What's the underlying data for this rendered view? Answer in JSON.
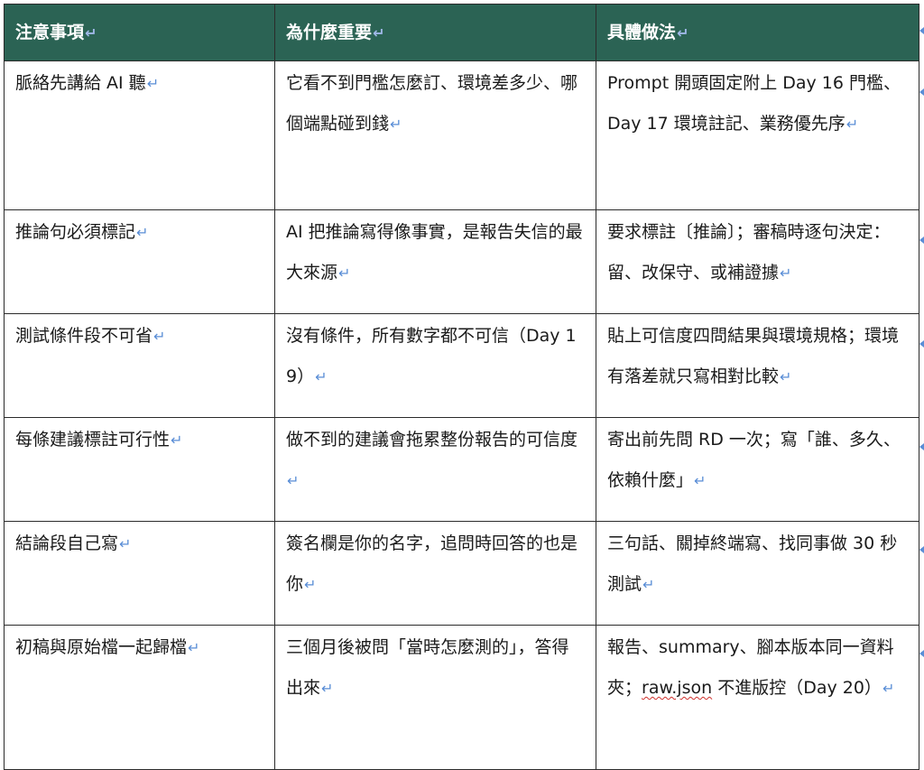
{
  "table": {
    "headers": [
      "注意事項",
      "為什麼重要",
      "具體做法"
    ],
    "rows": [
      {
        "item": "脈絡先講給 AI 聽",
        "why": "它看不到門檻怎麼訂、環境差多少、哪個端點碰到錢",
        "how": "Prompt 開頭固定附上 Day 16 門檻、Day 17 環境註記、業務優先序"
      },
      {
        "item": "推論句必須標記",
        "why": "AI 把推論寫得像事實，是報告失信的最大來源",
        "how": "要求標註〔推論〕；審稿時逐句決定：留、改保守、或補證據"
      },
      {
        "item": "測試條件段不可省",
        "why": "沒有條件，所有數字都不可信（Day 19）",
        "how": "貼上可信度四問結果與環境規格；環境有落差就只寫相對比較"
      },
      {
        "item": "每條建議標註可行性",
        "why": "做不到的建議會拖累整份報告的可信度",
        "how": "寄出前先問 RD 一次；寫「誰、多久、依賴什麼」"
      },
      {
        "item": "結論段自己寫",
        "why": "簽名欄是你的名字，追問時回答的也是你",
        "how": "三句話、關掉終端寫、找同事做 30 秒測試"
      },
      {
        "item": "初稿與原始檔一起歸檔",
        "why": "三個月後被問「當時怎麼測的」，答得出來",
        "how_before": "報告、summary、腳本版本同一資料夾；",
        "how_flagged": "raw.json",
        "how_after": " 不進版控（Day 20）"
      }
    ]
  },
  "paragraph_mark": "↵",
  "colors": {
    "header_bg": "#2b6354",
    "header_text": "#ffffff",
    "paragraph_mark": "#5a8ed6",
    "spellcheck_squiggle": "#d0312d"
  }
}
